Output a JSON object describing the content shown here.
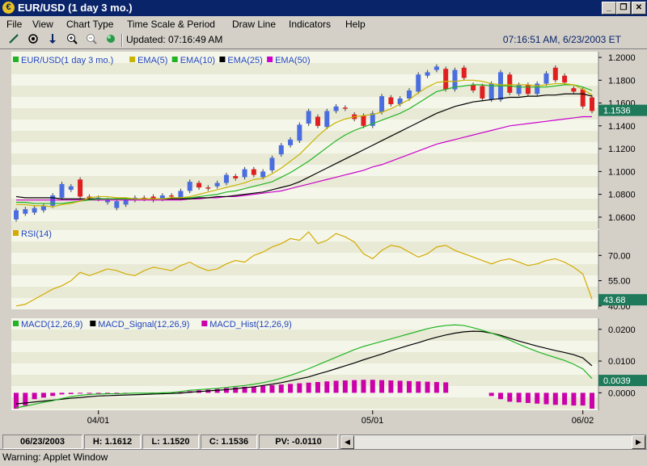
{
  "window": {
    "title": "EUR/USD (1 day  3 mo.)",
    "app_icon": "coin-icon",
    "minimize": "_",
    "restore": "❐",
    "close": "✕"
  },
  "menu": [
    "File",
    "View",
    "Chart Type",
    "Time Scale & Period",
    "Draw Line",
    "Indicators",
    "Help"
  ],
  "toolbar": {
    "updated": "Updated: 07:16:49 AM",
    "clock": "07:16:51 AM, 6/23/2003 ET",
    "tools": [
      "draw-line-icon",
      "crosshair-icon",
      "down-arrow-icon",
      "zoom-in-icon",
      "zoom-out-icon",
      "globe-icon"
    ]
  },
  "colors": {
    "bull": "#4a6ee0",
    "bear": "#e02020",
    "ema5": "#c8b400",
    "ema10": "#22b422",
    "ema25": "#000000",
    "ema50": "#cc00cc",
    "rsi": "#d4aa00",
    "macd": "#22b422",
    "signal": "#000000",
    "hist": "#cc00aa",
    "lastbg": "#1e7a5a"
  },
  "chart_data": [
    {
      "type": "candlestick",
      "title": "EUR/USD(1 day  3 mo.)",
      "legend": [
        "EUR/USD(1 day  3 mo.)",
        "EMA(5)",
        "EMA(10)",
        "EMA(25)",
        "EMA(50)"
      ],
      "yticks": [
        "1.0600",
        "1.0800",
        "1.1000",
        "1.1200",
        "1.1400",
        "1.1600",
        "1.1800",
        "1.2000"
      ],
      "ylim": [
        1.05,
        1.205
      ],
      "last": "1.1536",
      "candles": [
        [
          1.058,
          1.066
        ],
        [
          1.063,
          1.067
        ],
        [
          1.064,
          1.068
        ],
        [
          1.066,
          1.07
        ],
        [
          1.07,
          1.079
        ],
        [
          1.077,
          1.089
        ],
        [
          1.084,
          1.087
        ],
        [
          1.093,
          1.078
        ],
        [
          1.078,
          1.077
        ],
        [
          1.076,
          1.077
        ],
        [
          1.073,
          1.075
        ],
        [
          1.068,
          1.074
        ],
        [
          1.071,
          1.075
        ],
        [
          1.075,
          1.077
        ],
        [
          1.077,
          1.076
        ],
        [
          1.078,
          1.075
        ],
        [
          1.076,
          1.079
        ],
        [
          1.079,
          1.078
        ],
        [
          1.077,
          1.083
        ],
        [
          1.083,
          1.091
        ],
        [
          1.09,
          1.086
        ],
        [
          1.086,
          1.085
        ],
        [
          1.087,
          1.09
        ],
        [
          1.09,
          1.097
        ],
        [
          1.096,
          1.094
        ],
        [
          1.095,
          1.102
        ],
        [
          1.102,
          1.097
        ],
        [
          1.095,
          1.1
        ],
        [
          1.101,
          1.112
        ],
        [
          1.115,
          1.123
        ],
        [
          1.123,
          1.128
        ],
        [
          1.127,
          1.141
        ],
        [
          1.142,
          1.153
        ],
        [
          1.148,
          1.14
        ],
        [
          1.139,
          1.153
        ],
        [
          1.153,
          1.157
        ],
        [
          1.156,
          1.155
        ],
        [
          1.15,
          1.146
        ],
        [
          1.149,
          1.14
        ],
        [
          1.14,
          1.151
        ],
        [
          1.152,
          1.166
        ],
        [
          1.165,
          1.159
        ],
        [
          1.159,
          1.164
        ],
        [
          1.164,
          1.171
        ],
        [
          1.17,
          1.185
        ],
        [
          1.184,
          1.187
        ],
        [
          1.189,
          1.192
        ],
        [
          1.19,
          1.172
        ],
        [
          1.172,
          1.189
        ],
        [
          1.191,
          1.182
        ],
        [
          1.176,
          1.171
        ],
        [
          1.175,
          1.164
        ],
        [
          1.163,
          1.177
        ],
        [
          1.163,
          1.187
        ],
        [
          1.185,
          1.169
        ],
        [
          1.168,
          1.176
        ],
        [
          1.176,
          1.168
        ],
        [
          1.168,
          1.177
        ],
        [
          1.177,
          1.186
        ],
        [
          1.191,
          1.18
        ],
        [
          1.184,
          1.178
        ],
        [
          1.173,
          1.17
        ],
        [
          1.172,
          1.157
        ],
        [
          1.165,
          1.153
        ]
      ],
      "ema5": [
        1.071,
        1.071,
        1.07,
        1.07,
        1.069,
        1.071,
        1.072,
        1.074,
        1.077,
        1.078,
        1.078,
        1.077,
        1.077,
        1.076,
        1.076,
        1.076,
        1.076,
        1.077,
        1.077,
        1.078,
        1.08,
        1.082,
        1.084,
        1.086,
        1.088,
        1.09,
        1.093,
        1.094,
        1.098,
        1.103,
        1.109,
        1.115,
        1.123,
        1.131,
        1.138,
        1.143,
        1.146,
        1.148,
        1.149,
        1.15,
        1.152,
        1.155,
        1.159,
        1.163,
        1.169,
        1.174,
        1.178,
        1.179,
        1.179,
        1.18,
        1.18,
        1.179,
        1.177,
        1.176,
        1.176,
        1.176,
        1.176,
        1.175,
        1.176,
        1.177,
        1.177,
        1.176,
        1.172,
        1.167
      ],
      "ema10": [
        1.073,
        1.073,
        1.072,
        1.072,
        1.072,
        1.072,
        1.073,
        1.074,
        1.075,
        1.076,
        1.076,
        1.076,
        1.076,
        1.076,
        1.076,
        1.076,
        1.076,
        1.077,
        1.077,
        1.077,
        1.078,
        1.079,
        1.08,
        1.082,
        1.083,
        1.085,
        1.087,
        1.089,
        1.091,
        1.095,
        1.099,
        1.104,
        1.109,
        1.115,
        1.121,
        1.127,
        1.132,
        1.136,
        1.139,
        1.142,
        1.145,
        1.148,
        1.151,
        1.155,
        1.16,
        1.165,
        1.17,
        1.172,
        1.174,
        1.175,
        1.176,
        1.176,
        1.175,
        1.175,
        1.175,
        1.174,
        1.174,
        1.174,
        1.174,
        1.175,
        1.176,
        1.176,
        1.174,
        1.171
      ],
      "ema25": [
        1.078,
        1.077,
        1.077,
        1.077,
        1.077,
        1.076,
        1.076,
        1.076,
        1.076,
        1.076,
        1.076,
        1.076,
        1.076,
        1.076,
        1.076,
        1.076,
        1.076,
        1.076,
        1.076,
        1.076,
        1.077,
        1.077,
        1.078,
        1.078,
        1.079,
        1.08,
        1.081,
        1.082,
        1.084,
        1.086,
        1.088,
        1.091,
        1.095,
        1.099,
        1.103,
        1.107,
        1.111,
        1.115,
        1.119,
        1.123,
        1.127,
        1.131,
        1.135,
        1.139,
        1.143,
        1.147,
        1.151,
        1.154,
        1.157,
        1.159,
        1.161,
        1.162,
        1.163,
        1.164,
        1.165,
        1.165,
        1.166,
        1.166,
        1.167,
        1.167,
        1.168,
        1.168,
        1.168,
        1.166
      ],
      "ema50": [
        1.075,
        1.075,
        1.075,
        1.075,
        1.075,
        1.075,
        1.075,
        1.075,
        1.075,
        1.075,
        1.075,
        1.075,
        1.075,
        1.075,
        1.075,
        1.075,
        1.075,
        1.075,
        1.075,
        1.076,
        1.076,
        1.077,
        1.077,
        1.078,
        1.078,
        1.079,
        1.08,
        1.081,
        1.082,
        1.083,
        1.085,
        1.087,
        1.089,
        1.091,
        1.093,
        1.095,
        1.097,
        1.099,
        1.101,
        1.104,
        1.106,
        1.109,
        1.112,
        1.115,
        1.118,
        1.121,
        1.124,
        1.126,
        1.128,
        1.13,
        1.132,
        1.134,
        1.136,
        1.138,
        1.14,
        1.141,
        1.142,
        1.143,
        1.144,
        1.145,
        1.146,
        1.147,
        1.148,
        1.148
      ]
    },
    {
      "type": "line",
      "title": "RSI(14)",
      "legend": [
        "RSI(14)"
      ],
      "yticks": [
        "40.00",
        "55.00",
        "70.00"
      ],
      "ylim": [
        38,
        85
      ],
      "last": "43.68",
      "values": [
        40,
        41,
        44,
        47,
        50,
        52,
        55,
        60,
        58,
        60,
        62,
        61,
        59,
        58,
        61,
        63,
        62,
        61,
        64,
        66,
        63,
        61,
        62,
        65,
        67,
        66,
        70,
        72,
        75,
        77,
        80,
        79,
        84,
        77,
        79,
        83,
        81,
        78,
        71,
        68,
        73,
        76,
        75,
        72,
        69,
        71,
        75,
        76,
        73,
        71,
        69,
        67,
        65,
        67,
        68,
        66,
        64,
        65,
        67,
        68,
        66,
        63,
        59,
        44
      ]
    },
    {
      "type": "line",
      "title": "MACD",
      "legend": [
        "MACD(12,26,9)",
        "MACD_Signal(12,26,9)",
        "MACD_Hist(12,26,9)"
      ],
      "yticks": [
        "0.0000",
        "0.0100",
        "0.0200"
      ],
      "ylim": [
        -0.0055,
        0.0235
      ],
      "last": "0.0039",
      "macd": [
        -0.0047,
        -0.0042,
        -0.0036,
        -0.003,
        -0.0025,
        -0.0018,
        -0.0012,
        -0.0008,
        -0.0005,
        -0.0004,
        -0.0003,
        -0.0003,
        -0.0002,
        -0.0001,
        -0.0001,
        -0.0001,
        0.0,
        0.0001,
        0.0004,
        0.0008,
        0.001,
        0.0012,
        0.0014,
        0.0017,
        0.002,
        0.0023,
        0.0027,
        0.0032,
        0.0038,
        0.0046,
        0.0055,
        0.0065,
        0.0076,
        0.0088,
        0.01,
        0.0112,
        0.0124,
        0.0136,
        0.0146,
        0.0154,
        0.0162,
        0.017,
        0.0178,
        0.0186,
        0.0194,
        0.0202,
        0.0208,
        0.0212,
        0.0214,
        0.0212,
        0.0205,
        0.0197,
        0.0188,
        0.0178,
        0.0166,
        0.0153,
        0.0141,
        0.013,
        0.012,
        0.0111,
        0.0102,
        0.009,
        0.0075,
        0.0045
      ],
      "signal": [
        -0.0035,
        -0.0032,
        -0.0029,
        -0.0026,
        -0.0023,
        -0.002,
        -0.0017,
        -0.0015,
        -0.0012,
        -0.001,
        -0.0009,
        -0.0008,
        -0.0007,
        -0.0006,
        -0.0005,
        -0.0004,
        -0.0003,
        -0.0002,
        -0.0001,
        0.0002,
        0.0004,
        0.0006,
        0.0008,
        0.001,
        0.0013,
        0.0016,
        0.0019,
        0.0023,
        0.0027,
        0.0032,
        0.0038,
        0.0044,
        0.005,
        0.0059,
        0.0067,
        0.0076,
        0.0085,
        0.0094,
        0.0104,
        0.0113,
        0.0122,
        0.0132,
        0.0141,
        0.015,
        0.0158,
        0.0167,
        0.0175,
        0.0182,
        0.0188,
        0.0192,
        0.0194,
        0.0193,
        0.0188,
        0.0181,
        0.0172,
        0.0163,
        0.0155,
        0.0147,
        0.014,
        0.0133,
        0.0127,
        0.012,
        0.011,
        0.0085
      ],
      "hist": [
        -0.005,
        -0.004,
        -0.002,
        -0.0015,
        -0.001,
        -0.0005,
        -0.0004,
        -0.0002,
        -0.0001,
        -0.0001,
        -0.0001,
        -0.0001,
        -0.0001,
        0.0,
        0.0,
        0.0001,
        0.0001,
        0.0001,
        0.0002,
        0.0005,
        0.0008,
        0.001,
        0.0012,
        0.0015,
        0.0017,
        0.0019,
        0.002,
        0.0022,
        0.0024,
        0.0026,
        0.0028,
        0.003,
        0.0032,
        0.0034,
        0.0036,
        0.0038,
        0.0039,
        0.004,
        0.0041,
        0.0041,
        0.004,
        0.0039,
        0.0038,
        0.0037,
        0.0036,
        0.0035,
        0.0034,
        0.0033,
        0.0,
        0.0,
        0.0,
        0.0,
        -0.001,
        -0.002,
        -0.0028,
        -0.003,
        -0.0032,
        -0.0034,
        -0.0036,
        -0.0038,
        -0.0038,
        -0.004,
        -0.004,
        -0.005
      ],
      "xticks": [
        "04/01",
        "05/01",
        "06/02"
      ],
      "xtick_index": [
        9,
        39,
        62
      ]
    }
  ],
  "status": {
    "date": "06/23/2003",
    "high": "H: 1.1612",
    "low": "L: 1.1520",
    "close": "C: 1.1536",
    "pv": "PV: -0.0110"
  },
  "warning": "Warning: Applet Window"
}
